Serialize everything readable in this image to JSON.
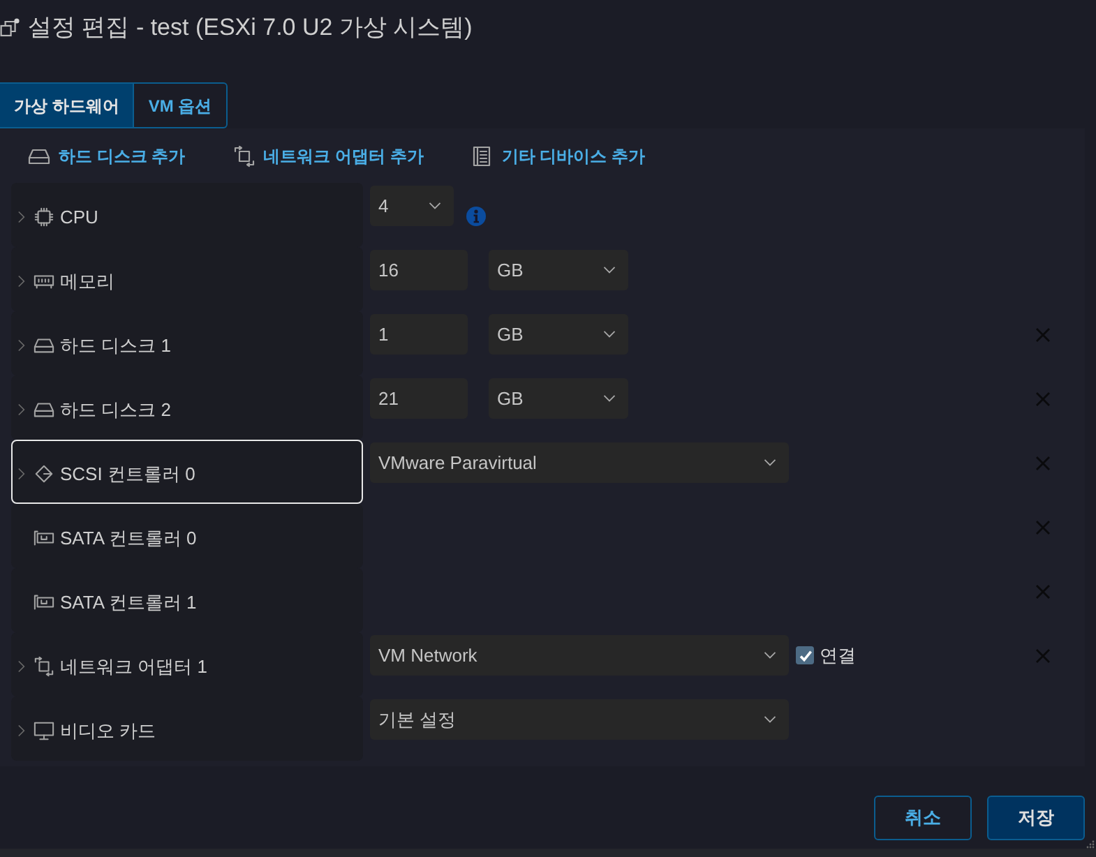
{
  "window": {
    "title": "설정 편집 - test (ESXi 7.0 U2 가상 시스템)"
  },
  "tabs": [
    {
      "label": "가상 하드웨어",
      "selected": true
    },
    {
      "label": "VM 옵션",
      "selected": false
    }
  ],
  "toolbar": [
    {
      "kind": "disk",
      "label": "하드 디스크 추가"
    },
    {
      "kind": "network",
      "label": "네트워크 어댑터 추가"
    },
    {
      "kind": "device",
      "label": "기타 디바이스 추가"
    }
  ],
  "devices": [
    {
      "kind": "cpu",
      "label": "CPU",
      "expandable": true,
      "focused": false,
      "removable": false,
      "controls": [
        {
          "kind": "count_select",
          "value": "4"
        },
        {
          "kind": "info"
        }
      ]
    },
    {
      "kind": "memory",
      "label": "메모리",
      "expandable": true,
      "focused": false,
      "removable": false,
      "controls": [
        {
          "kind": "number",
          "value": "16"
        },
        {
          "kind": "unit_select",
          "value": "GB"
        }
      ]
    },
    {
      "kind": "disk",
      "label": "하드 디스크 1",
      "expandable": true,
      "focused": false,
      "removable": true,
      "controls": [
        {
          "kind": "number",
          "value": "1"
        },
        {
          "kind": "unit_select",
          "value": "GB"
        }
      ]
    },
    {
      "kind": "disk",
      "label": "하드 디스크 2",
      "expandable": true,
      "focused": false,
      "removable": true,
      "controls": [
        {
          "kind": "number",
          "value": "21"
        },
        {
          "kind": "unit_select",
          "value": "GB"
        }
      ]
    },
    {
      "kind": "scsi",
      "label": "SCSI 컨트롤러 0",
      "expandable": true,
      "focused": true,
      "removable": true,
      "controls": [
        {
          "kind": "select",
          "value": "VMware Paravirtual"
        }
      ]
    },
    {
      "kind": "sata",
      "label": "SATA 컨트롤러 0",
      "expandable": false,
      "focused": false,
      "removable": true
    },
    {
      "kind": "sata",
      "label": "SATA 컨트롤러 1",
      "expandable": false,
      "focused": false,
      "removable": true
    },
    {
      "kind": "network",
      "label": "네트워크 어댑터 1",
      "expandable": true,
      "focused": false,
      "removable": true,
      "controls": [
        {
          "kind": "select",
          "value": "VM Network"
        },
        {
          "kind": "checkbox",
          "label": "연결",
          "checked": true
        }
      ]
    },
    {
      "kind": "video",
      "label": "비디오 카드",
      "expandable": true,
      "focused": false,
      "removable": false,
      "controls": [
        {
          "kind": "select",
          "value": "기본 설정"
        }
      ]
    }
  ],
  "buttons": [
    {
      "kind": "secondary",
      "label": "취소"
    },
    {
      "kind": "primary",
      "label": "저장"
    }
  ]
}
